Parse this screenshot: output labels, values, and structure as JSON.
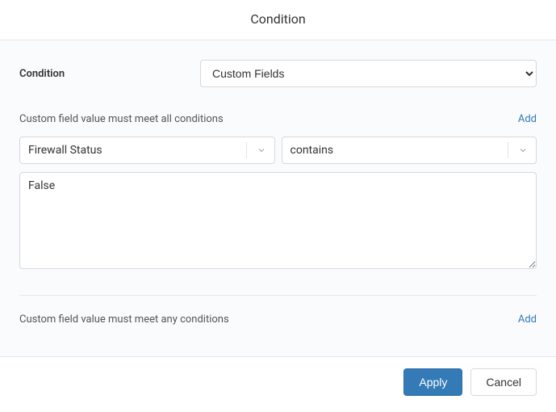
{
  "header": {
    "title": "Condition"
  },
  "main": {
    "condition_label": "Condition",
    "condition_value": "Custom Fields",
    "all_section": {
      "label": "Custom field value must meet all conditions",
      "add_label": "Add",
      "row": {
        "field": "Firewall Status",
        "operator": "contains",
        "value": "False"
      }
    },
    "any_section": {
      "label": "Custom field value must meet any conditions",
      "add_label": "Add"
    }
  },
  "footer": {
    "apply_label": "Apply",
    "cancel_label": "Cancel"
  }
}
